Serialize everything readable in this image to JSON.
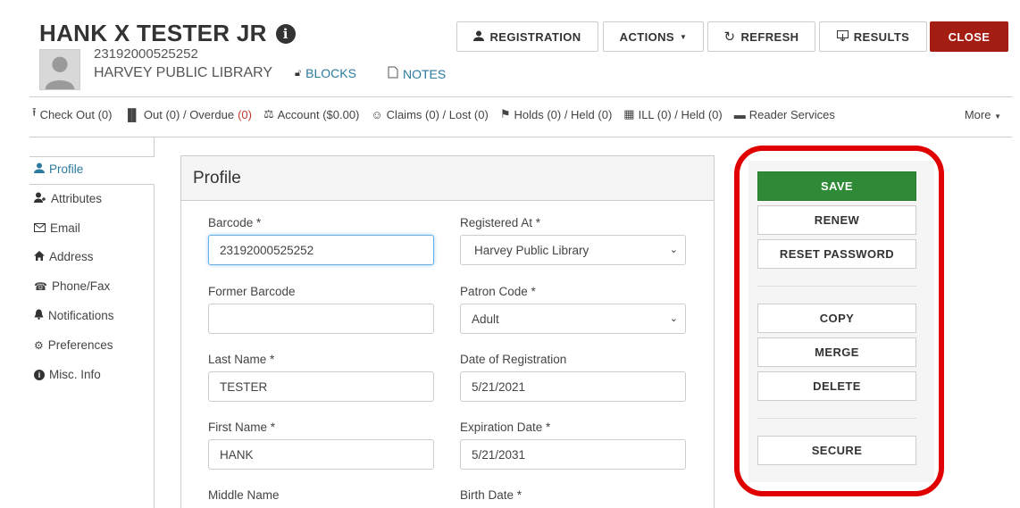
{
  "patron": {
    "name": "HANK X TESTER JR",
    "barcode": "23192000525252",
    "library": "HARVEY PUBLIC LIBRARY",
    "blocks_label": "BLOCKS",
    "notes_label": "NOTES"
  },
  "top_buttons": {
    "registration": "REGISTRATION",
    "actions": "ACTIONS",
    "refresh": "REFRESH",
    "results": "RESULTS",
    "close": "CLOSE"
  },
  "tabs": {
    "checkout": "Check Out (0)",
    "out_prefix": "Out (0) / Overdue ",
    "overdue": "(0)",
    "account": "Account ($0.00)",
    "claims": "Claims (0) / Lost (0)",
    "holds": "Holds (0) / Held (0)",
    "ill": "ILL (0) / Held (0)",
    "reader": "Reader Services",
    "more": "More"
  },
  "nav": {
    "profile": "Profile",
    "attributes": "Attributes",
    "email": "Email",
    "address": "Address",
    "phone": "Phone/Fax",
    "notifications": "Notifications",
    "preferences": "Preferences",
    "misc": "Misc. Info"
  },
  "form": {
    "title": "Profile",
    "barcode_label": "Barcode *",
    "barcode_value": "23192000525252",
    "registered_label": "Registered At *",
    "registered_value": "Harvey Public Library",
    "former_label": "Former Barcode",
    "former_value": "",
    "patron_code_label": "Patron Code *",
    "patron_code_value": "Adult",
    "last_label": "Last Name *",
    "last_value": "TESTER",
    "reg_date_label": "Date of Registration",
    "reg_date_value": "5/21/2021",
    "first_label": "First Name *",
    "first_value": "HANK",
    "exp_label": "Expiration Date *",
    "exp_value": "5/21/2031",
    "middle_label": "Middle Name",
    "birth_label": "Birth Date *"
  },
  "side_actions": {
    "save": "SAVE",
    "renew": "RENEW",
    "reset_password": "RESET PASSWORD",
    "copy": "COPY",
    "merge": "MERGE",
    "delete": "DELETE",
    "secure": "SECURE"
  },
  "colors": {
    "close": "#a31d12",
    "save": "#2f8a37",
    "link": "#2c7a9e",
    "highlight": "#e00000"
  }
}
